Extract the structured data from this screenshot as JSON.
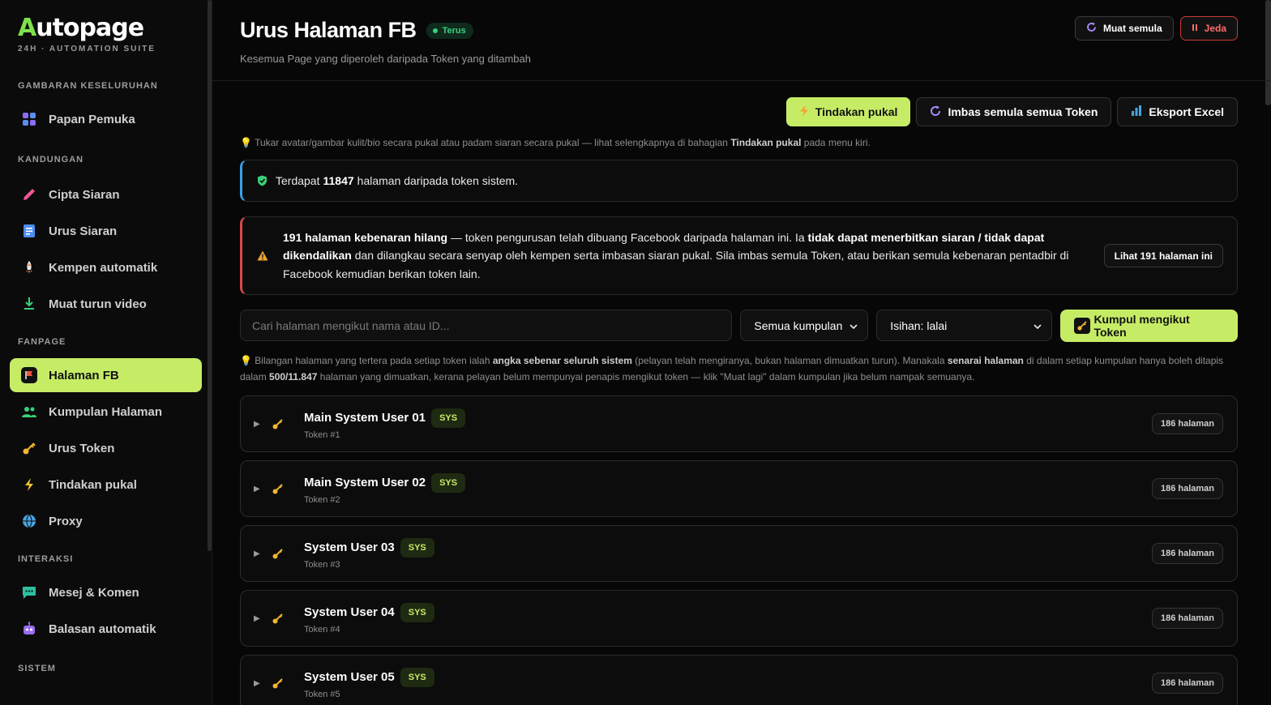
{
  "brand": {
    "name_a": "A",
    "name_rest": "utopage",
    "tagline": "24H · AUTOMATION SUITE",
    "accent": "#c6ec66"
  },
  "sidebar": {
    "sections": [
      {
        "title": "GAMBARAN KESELURUHAN",
        "items": [
          {
            "label": "Papan Pemuka",
            "icon": "dashboard-icon"
          }
        ]
      },
      {
        "title": "KANDUNGAN",
        "items": [
          {
            "label": "Cipta Siaran",
            "icon": "pencil-icon"
          },
          {
            "label": "Urus Siaran",
            "icon": "document-icon"
          },
          {
            "label": "Kempen automatik",
            "icon": "rocket-icon"
          },
          {
            "label": "Muat turun video",
            "icon": "download-icon"
          }
        ]
      },
      {
        "title": "FANPAGE",
        "items": [
          {
            "label": "Halaman FB",
            "icon": "flag-icon",
            "active": true
          },
          {
            "label": "Kumpulan Halaman",
            "icon": "users-icon"
          },
          {
            "label": "Urus Token",
            "icon": "key-icon"
          },
          {
            "label": "Tindakan pukal",
            "icon": "lightning-icon"
          },
          {
            "label": "Proxy",
            "icon": "globe-icon"
          }
        ]
      },
      {
        "title": "INTERAKSI",
        "items": [
          {
            "label": "Mesej & Komen",
            "icon": "chat-icon"
          },
          {
            "label": "Balasan automatik",
            "icon": "robot-icon"
          }
        ]
      },
      {
        "title": "SISTEM",
        "items": []
      }
    ]
  },
  "header": {
    "title": "Urus Halaman FB",
    "live_badge": "Terus",
    "subtitle": "Kesemua Page yang diperoleh daripada Token yang ditambah",
    "reload_label": "Muat semula",
    "pause_label": "Jeda"
  },
  "actions": {
    "bulk_label": "Tindakan pukal",
    "resync_label": "Imbas semula semua Token",
    "export_label": "Eksport Excel"
  },
  "tip": {
    "pre": "Tukar avatar/gambar kulit/bio secara pukal atau padam siaran secara pukal — lihat selengkapnya di bahagian ",
    "bold": "Tindakan pukal",
    "post": " pada menu kiri."
  },
  "info": {
    "pre": "Terdapat ",
    "count": "11847",
    "post": " halaman daripada token sistem."
  },
  "warning": {
    "bold1": "191 halaman kebenaran hilang",
    "text1": " — token pengurusan telah dibuang Facebook daripada halaman ini. Ia ",
    "bold2": "tidak dapat menerbitkan siaran / tidak dapat dikendalikan",
    "text2": " dan dilangkau secara senyap oleh kempen serta imbasan siaran pukal. Sila imbas semula Token, atau berikan semula kebenaran pentadbir di Facebook kemudian berikan token lain.",
    "button": "Lihat 191 halaman ini"
  },
  "filters": {
    "search_placeholder": "Cari halaman mengikut nama atau ID...",
    "group_select": "Semua kumpulan",
    "sort_select": "Isihan: lalai",
    "group_by_token": "Kumpul mengikut Token"
  },
  "note": {
    "t1": "Bilangan halaman yang tertera pada setiap token ialah ",
    "b1": "angka sebenar seluruh sistem",
    "t2": " (pelayan telah mengiranya, bukan halaman dimuatkan turun). Manakala ",
    "b2": "senarai halaman",
    "t3": " di dalam setiap kumpulan hanya boleh ditapis dalam ",
    "b3": "500/11.847",
    "t4": " halaman yang dimuatkan, kerana pelayan belum mempunyai penapis mengikut token — klik \"Muat lagi\" dalam kumpulan jika belum nampak semuanya."
  },
  "tokens": [
    {
      "name": "Main System User 01",
      "badge": "SYS",
      "sub": "Token #1",
      "count": "186 halaman"
    },
    {
      "name": "Main System User 02",
      "badge": "SYS",
      "sub": "Token #2",
      "count": "186 halaman"
    },
    {
      "name": "System User 03",
      "badge": "SYS",
      "sub": "Token #3",
      "count": "186 halaman"
    },
    {
      "name": "System User 04",
      "badge": "SYS",
      "sub": "Token #4",
      "count": "186 halaman"
    },
    {
      "name": "System User 05",
      "badge": "SYS",
      "sub": "Token #5",
      "count": "186 halaman"
    }
  ]
}
